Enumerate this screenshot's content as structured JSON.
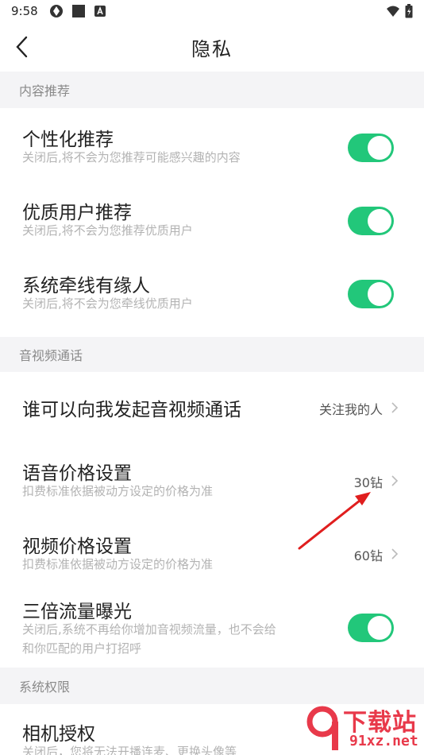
{
  "status_bar": {
    "time": "9:58"
  },
  "nav": {
    "title": "隐私"
  },
  "sections": {
    "content": "内容推荐",
    "av_call": "音视频通话",
    "system": "系统权限"
  },
  "rows": {
    "personalized": {
      "title": "个性化推荐",
      "subtitle": "关闭后,将不会为您推荐可能感兴趣的内容",
      "enabled": true
    },
    "quality_user": {
      "title": "优质用户推荐",
      "subtitle": "关闭后,将不会为您推荐优质用户",
      "enabled": true
    },
    "matchmaking": {
      "title": "系统牵线有缘人",
      "subtitle": "关闭后,将不会为您牵线优质用户",
      "enabled": true
    },
    "who_can_call": {
      "title": "谁可以向我发起音视频通话",
      "value": "关注我的人"
    },
    "voice_price": {
      "title": "语音价格设置",
      "subtitle": "扣费标准依据被动方设定的价格为准",
      "value": "30钻"
    },
    "video_price": {
      "title": "视频价格设置",
      "subtitle": "扣费标准依据被动方设定的价格为准",
      "value": "60钻"
    },
    "triple_exposure": {
      "title": "三倍流量曝光",
      "subtitle_line1": "关闭后,系统不再给你增加音视频流量，也不会给",
      "subtitle_line2": "和你匹配的用户打招呼",
      "enabled": true
    },
    "camera": {
      "title": "相机授权",
      "subtitle": "关闭后，您将无法开播连麦、更换头像等"
    }
  },
  "watermark": {
    "cn": "下载站",
    "en": "91xz.net"
  },
  "colors": {
    "toggle_on": "#22c77a",
    "section_bg": "#f4f4f6",
    "annotation_arrow": "#e01e1e",
    "watermark": "#e8394a"
  }
}
